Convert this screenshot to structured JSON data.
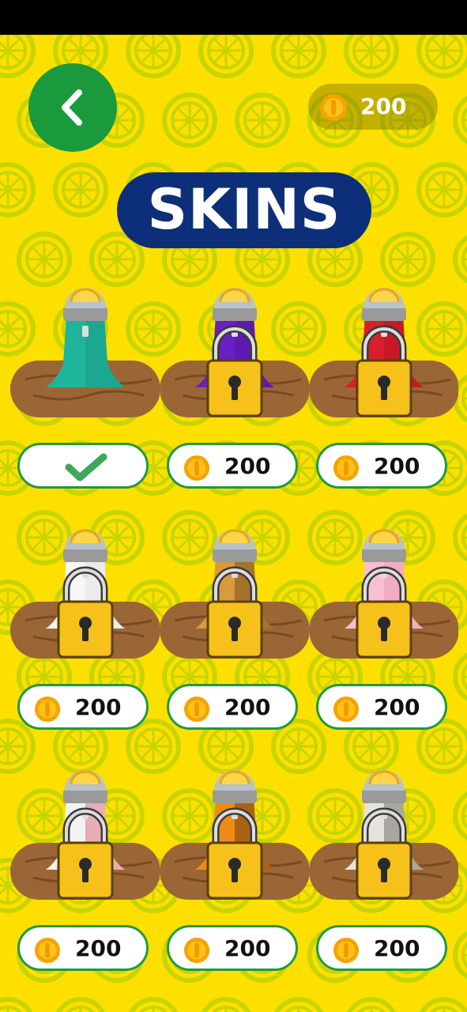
{
  "header": {
    "title": "SKINS",
    "coins": "200"
  },
  "colors": {
    "background": "#fde000",
    "accent_green": "#1a9a3d",
    "title_outline": "#0d2f7a"
  },
  "skins": [
    {
      "pattern": "teal",
      "owned": true,
      "locked": false,
      "price": ""
    },
    {
      "pattern": "purple",
      "owned": false,
      "locked": true,
      "price": "200"
    },
    {
      "pattern": "red-polka",
      "owned": false,
      "locked": true,
      "price": "200"
    },
    {
      "pattern": "white-confetti",
      "owned": false,
      "locked": true,
      "price": "200"
    },
    {
      "pattern": "leopard",
      "owned": false,
      "locked": true,
      "price": "200"
    },
    {
      "pattern": "pink-lace",
      "owned": false,
      "locked": true,
      "price": "200"
    },
    {
      "pattern": "red-stripes",
      "owned": false,
      "locked": true,
      "price": "200"
    },
    {
      "pattern": "tiger",
      "owned": false,
      "locked": true,
      "price": "200"
    },
    {
      "pattern": "snow-leopard",
      "owned": false,
      "locked": true,
      "price": "200"
    }
  ]
}
